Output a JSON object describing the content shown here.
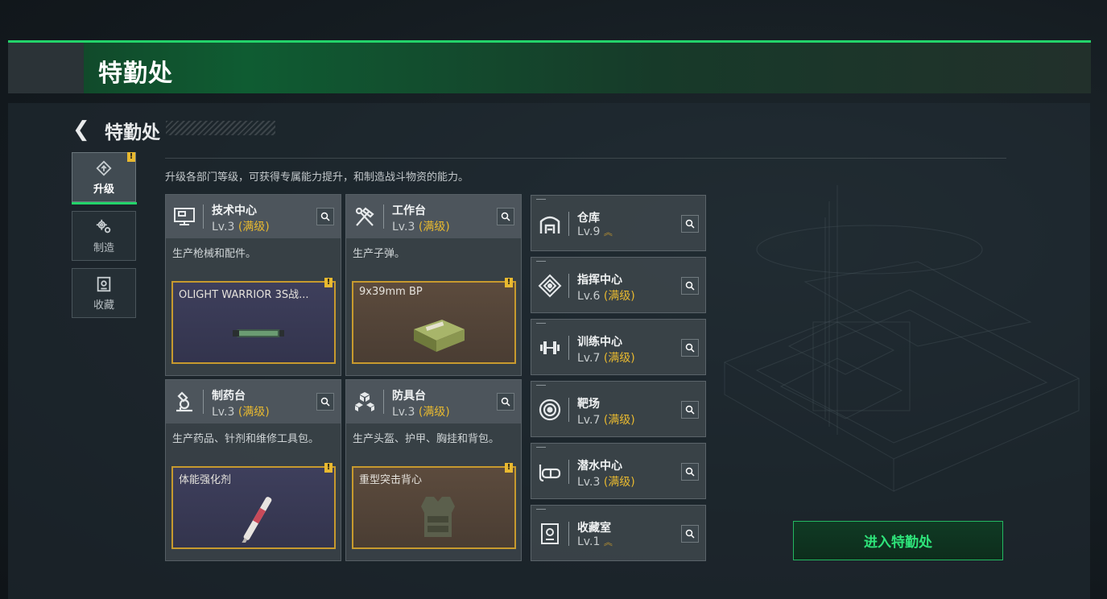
{
  "banner": {
    "title": "特勤处"
  },
  "header": {
    "title": "特勤处"
  },
  "tabs": [
    {
      "label": "升级",
      "icon": "upgrade-icon",
      "active": true
    },
    {
      "label": "制造",
      "icon": "gears-icon",
      "active": false
    },
    {
      "label": "收藏",
      "icon": "collection-icon",
      "active": false
    }
  ],
  "tab_badge": "!",
  "description": "升级各部门等级，可获得专属能力提升，和制造战斗物资的能力。",
  "stations": [
    {
      "name": "技术中心",
      "level": "Lv.3",
      "max": "(满级)",
      "desc": "生产枪械和配件。",
      "product": "OLIGHT WARRIOR 3S战...",
      "product_badge": "!",
      "icon": "computer-icon"
    },
    {
      "name": "工作台",
      "level": "Lv.3",
      "max": "(满级)",
      "desc": "生产子弹。",
      "product": "9x39mm BP",
      "product_badge": "!",
      "icon": "hammer-wrench-icon"
    },
    {
      "name": "制药台",
      "level": "Lv.3",
      "max": "(满级)",
      "desc": "生产药品、针剂和维修工具包。",
      "product": "体能强化剂",
      "product_badge": "!",
      "icon": "microscope-icon"
    },
    {
      "name": "防具台",
      "level": "Lv.3",
      "max": "(满级)",
      "desc": "生产头盔、护甲、胸挂和背包。",
      "product": "重型突击背心",
      "product_badge": "!",
      "icon": "armor-cubes-icon"
    }
  ],
  "facilities": [
    {
      "name": "仓库",
      "level": "Lv.9",
      "max": "",
      "upgradeable": true,
      "icon": "warehouse-icon"
    },
    {
      "name": "指挥中心",
      "level": "Lv.6",
      "max": "(满级)",
      "upgradeable": false,
      "icon": "command-icon"
    },
    {
      "name": "训练中心",
      "level": "Lv.7",
      "max": "(满级)",
      "upgradeable": false,
      "icon": "dumbbell-icon"
    },
    {
      "name": "靶场",
      "level": "Lv.7",
      "max": "(满级)",
      "upgradeable": false,
      "icon": "target-icon"
    },
    {
      "name": "潜水中心",
      "level": "Lv.3",
      "max": "(满级)",
      "upgradeable": false,
      "icon": "diving-mask-icon"
    },
    {
      "name": "收藏室",
      "level": "Lv.1",
      "max": "",
      "upgradeable": true,
      "icon": "collection-room-icon"
    }
  ],
  "enter_button": "进入特勤处",
  "colors": {
    "accent_green": "#23d36a",
    "max_level_gold": "#e8b930",
    "product_border": "#c79a2e"
  }
}
